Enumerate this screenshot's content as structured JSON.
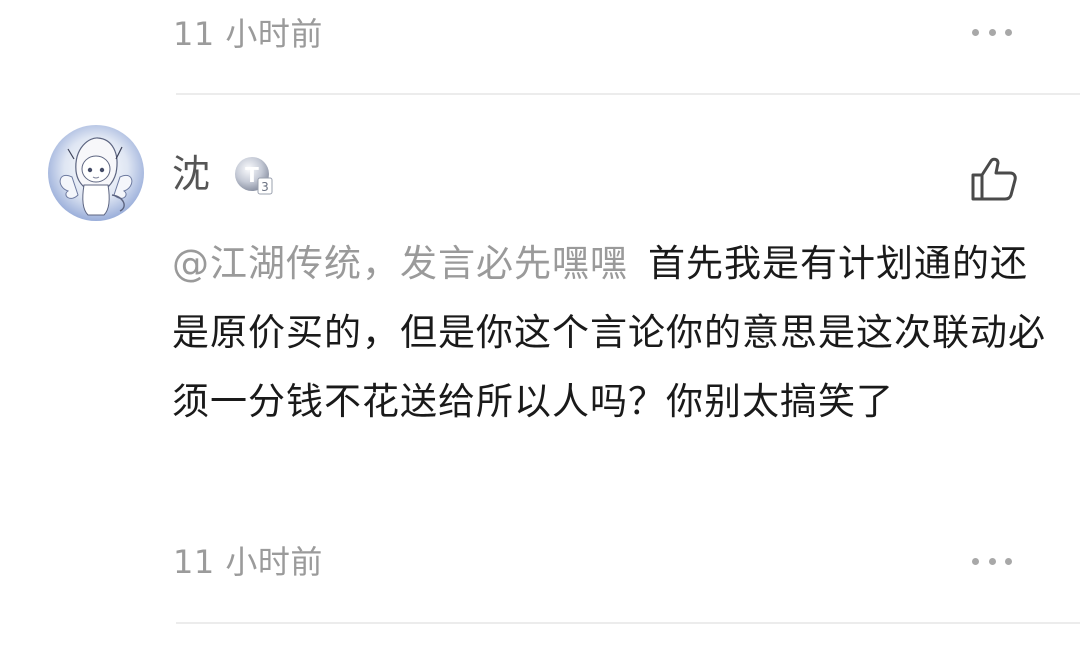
{
  "previous_comment": {
    "timestamp": "11 小时前"
  },
  "comment": {
    "username": "沈",
    "level_badge": "T3",
    "mention": "@江湖传统，发言必先嘿嘿",
    "text": "首先我是有计划通的还是原价买的，但是你这个言论你的意思是这次联动必须一分钱不花送给所以人吗？你别太搞笑了",
    "timestamp": "11 小时前"
  },
  "icons": {
    "like": "thumbs-up-icon",
    "more": "more-dots-icon",
    "badge": "level-badge-icon"
  },
  "colors": {
    "meta_text": "#9b9b9b",
    "mention": "#9a9a9a",
    "divider": "#ececec"
  }
}
